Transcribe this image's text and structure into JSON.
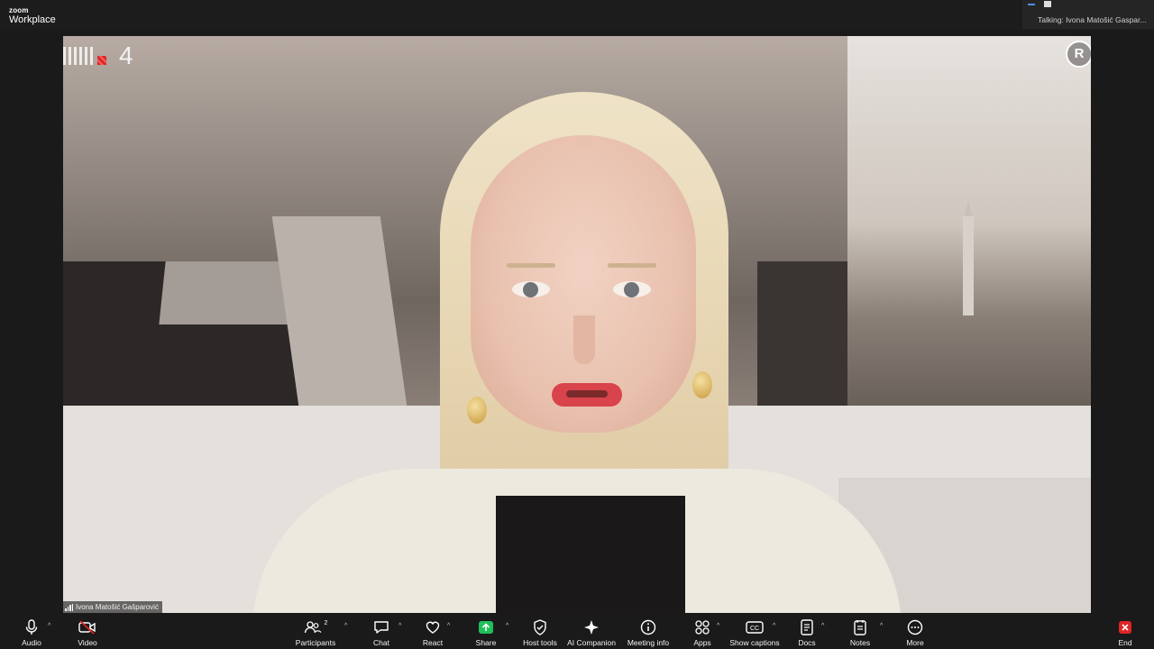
{
  "app": {
    "logo_line1": "zoom",
    "logo_line2": "Workplace"
  },
  "talking": {
    "text": "Talking: Ivona Matošić Gaspar..."
  },
  "video": {
    "channel_number": "4",
    "badge_letter": "R",
    "participant_name": "Ivona Matošić Gašparović"
  },
  "toolbar": {
    "audio": "Audio",
    "video": "Video",
    "participants": "Participants",
    "participants_count": "2",
    "chat": "Chat",
    "react": "React",
    "share": "Share",
    "host_tools": "Host tools",
    "ai_companion": "AI Companion",
    "meeting_info": "Meeting info",
    "apps": "Apps",
    "show_captions": "Show captions",
    "docs": "Docs",
    "notes": "Notes",
    "more": "More",
    "end": "End"
  },
  "colors": {
    "share_green": "#1fbf5a",
    "end_red": "#e02424",
    "accent_blue": "#4a90e2"
  }
}
